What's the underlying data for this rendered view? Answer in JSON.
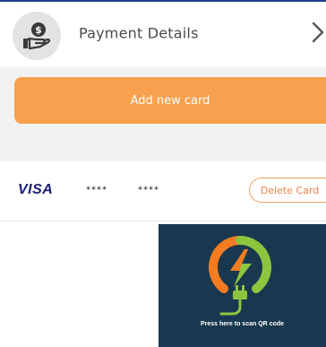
{
  "header": {
    "title": "Payment Details",
    "icon": "hand-coin-icon",
    "chevron": "chevron-right-icon"
  },
  "actions": {
    "add_card_label": "Add new card"
  },
  "card": {
    "brand": "VISA",
    "group1": "****",
    "group2": "****",
    "delete_label": "Delete Card"
  },
  "qr": {
    "caption": "Press here to scan QR code",
    "logo_icon": "ev-charging-plug-logo"
  },
  "colors": {
    "accent": "#f7a14e",
    "panel": "#18384f",
    "visa": "#1a1f71",
    "logo_orange": "#f47b20",
    "logo_green": "#8cc63f"
  }
}
